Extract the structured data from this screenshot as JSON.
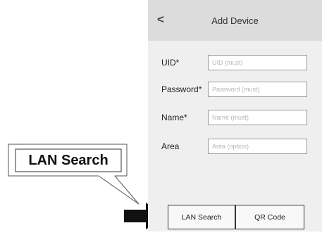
{
  "header": {
    "back_icon": "<",
    "title": "Add Device"
  },
  "form": {
    "fields": [
      {
        "label": "UID*",
        "placeholder": "UID (must)",
        "value": ""
      },
      {
        "label": "Password*",
        "placeholder": "Password (must)",
        "value": ""
      },
      {
        "label": "Name*",
        "placeholder": "Name (must)",
        "value": ""
      },
      {
        "label": "Area",
        "placeholder": "Area (option)",
        "value": ""
      }
    ]
  },
  "buttons": {
    "lan_search": "LAN Search",
    "qr_code": "QR Code"
  },
  "callout": {
    "label": "LAN Search",
    "icon": "arrow-right-icon"
  }
}
